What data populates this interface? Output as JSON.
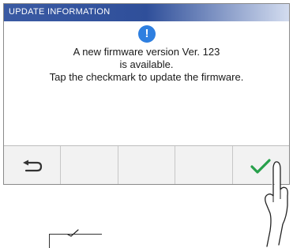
{
  "dialog": {
    "title": "UPDATE INFORMATION",
    "icon": "exclamation-icon",
    "icon_glyph": "!",
    "message_lines": [
      "A new firmware version Ver. 123",
      "is available.",
      "Tap the checkmark to update the firmware."
    ]
  },
  "toolbar": {
    "buttons": [
      {
        "name": "back-button",
        "icon": "back-arrow-icon"
      },
      {
        "name": "empty-button-2",
        "icon": ""
      },
      {
        "name": "empty-button-3",
        "icon": ""
      },
      {
        "name": "empty-button-4",
        "icon": ""
      },
      {
        "name": "confirm-button",
        "icon": "checkmark-icon"
      }
    ]
  },
  "colors": {
    "titlebar": "#3a5aa3",
    "info_icon": "#2e7fe0",
    "checkmark": "#27a04b"
  }
}
